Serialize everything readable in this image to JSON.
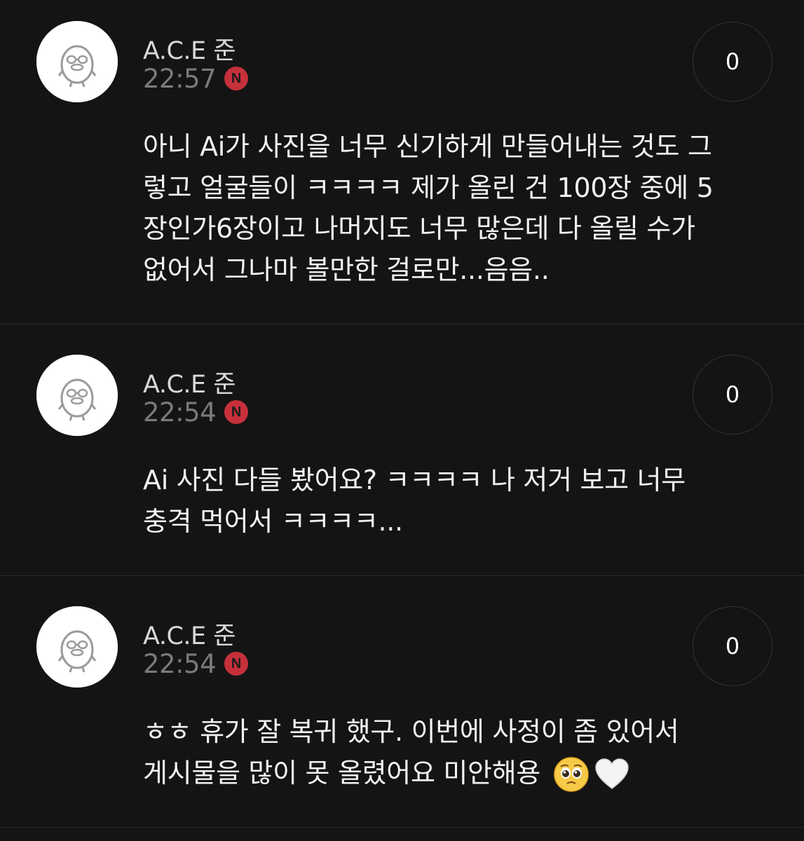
{
  "comments": [
    {
      "author": "A.C.E 준",
      "time": "22:57",
      "badge": "N",
      "likes": "0",
      "text": "아니 Ai가 사진을 너무 신기하게 만들어내는 것도 그\n렇고 얼굴들이 ㅋㅋㅋㅋ 제가 올린 건 100장 중에 5\n장인가6장이고 나머지도 너무 많은데 다 올릴 수가\n없어서 그나마 볼만한 걸로만...음음.."
    },
    {
      "author": "A.C.E 준",
      "time": "22:54",
      "badge": "N",
      "likes": "0",
      "text": "Ai 사진 다들 봤어요? ㅋㅋㅋㅋ 나 저거 보고 너무\n충격 먹어서 ㅋㅋㅋㅋ..."
    },
    {
      "author": "A.C.E 준",
      "time": "22:54",
      "badge": "N",
      "likes": "0",
      "text": "ㅎㅎ 휴가 잘 복귀 했구. 이번에 사정이 좀 있어서\n게시물을 많이 못 올렸어요 미안해용 ",
      "emojis": [
        "pleading-face-emoji",
        "white-heart-emoji"
      ]
    }
  ],
  "colors": {
    "background": "#141414",
    "badge": "#c6303a",
    "time": "#7a7a7a",
    "divider": "#2b2b2b"
  }
}
